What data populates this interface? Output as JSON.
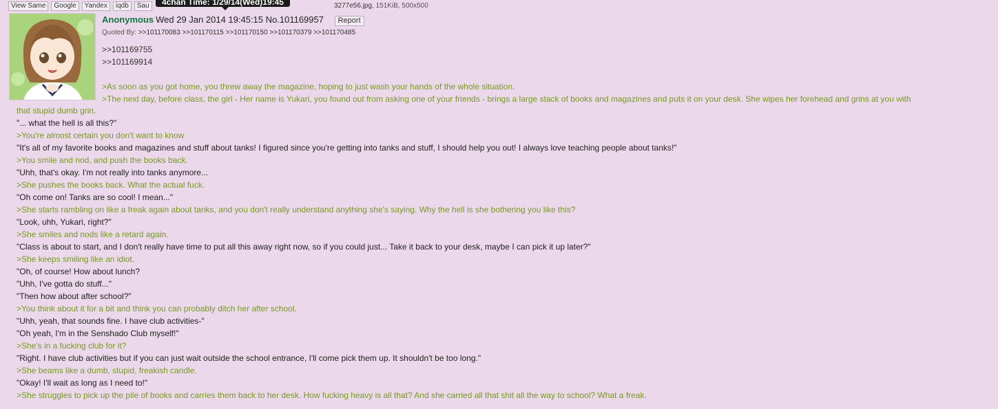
{
  "toolbar": {
    "buttons": [
      "View Same",
      "Google",
      "Yandex",
      "iqdb",
      "Sau"
    ]
  },
  "tooltip": "4chan Time: 1/29/14(Wed)19:45",
  "file": {
    "name_tail": "3277e56.jpg",
    "meta": ", 151KiB, 500x500"
  },
  "post": {
    "name": "Anonymous",
    "datetime": "Wed 29 Jan 2014 19:45:15",
    "number": "No.101169957",
    "report": "Report",
    "quoted_label": "Quoted By:",
    "quoted_by": [
      ">>101170083",
      ">>101170115",
      ">>101170150",
      ">>101170379",
      ">>101170485"
    ],
    "replies": [
      ">>101169755",
      ">>101169914"
    ],
    "lines_top": [
      ">As soon as you got home, you threw away the magazine, hoping to just wash your hands of the whole situation.",
      ">The next day, before class, the girl - Her name is Yukari, you found out from asking one of your friends - brings a large stack of books and magazines and puts it on your desk. She wipes her forehead and grins at you with"
    ],
    "lines": [
      {
        "t": "that stupid dumb grin.",
        "g": true
      },
      {
        "t": "\"... what the hell is all this?\"",
        "g": false
      },
      {
        "t": ">You're almost certain you don't want to know",
        "g": true
      },
      {
        "t": "\"It's all of my favorite books and magazines and stuff about tanks! I figured since you're getting into tanks and stuff, I should help you out! I always love teaching people about tanks!\"",
        "g": false
      },
      {
        "t": ">You smile and nod, and push the books back.",
        "g": true
      },
      {
        "t": "\"Uhh, that's okay. I'm not really into tanks anymore...",
        "g": false
      },
      {
        "t": ">She pushes the books back. What the actual fuck.",
        "g": true
      },
      {
        "t": "\"Oh come on! Tanks are so cool! I mean...\"",
        "g": false
      },
      {
        "t": ">She starts rambling on like a freak again about tanks, and you don't really understand anything she's saying. Why the hell is she bothering you like this?",
        "g": true
      },
      {
        "t": "\"Look, uhh, Yukari, right?\"",
        "g": false
      },
      {
        "t": ">She smiles and nods like a retard again.",
        "g": true
      },
      {
        "t": "\"Class is about to start, and I don't really have time to put all this away right now, so if you could just... Take it back to your desk, maybe I can pick it up later?\"",
        "g": false
      },
      {
        "t": ">She keeps smiling like an idiot.",
        "g": true
      },
      {
        "t": "\"Oh, of course! How about lunch?",
        "g": false
      },
      {
        "t": "\"Uhh, I've gotta do stuff...\"",
        "g": false
      },
      {
        "t": "\"Then how about after school?\"",
        "g": false
      },
      {
        "t": ">You think about it for a bit and think you can probably ditch her after school.",
        "g": true
      },
      {
        "t": "\"Uhh, yeah, that sounds fine. I have club activities-\"",
        "g": false
      },
      {
        "t": "\"Oh yeah, I'm in the Senshado Club myself!\"",
        "g": false
      },
      {
        "t": ">She's in a fucking club for it?",
        "g": true
      },
      {
        "t": "\"Right. I have club activities but if you can just wait outside the school entrance, I'll come pick them up. It shouldn't be too long.\"",
        "g": false
      },
      {
        "t": ">She beams like a dumb, stupid, freakish candle.",
        "g": true
      },
      {
        "t": "\"Okay! I'll wait as long as I need to!\"",
        "g": false
      },
      {
        "t": ">She struggles to pick up the pile of books and carries them back to her desk. How fucking heavy is all that? And she carried all that shit all the way to school? What a freak.",
        "g": true
      }
    ]
  },
  "colors": {
    "background": "#ebd8ea",
    "name": "#117743",
    "greentext": "#789922"
  }
}
